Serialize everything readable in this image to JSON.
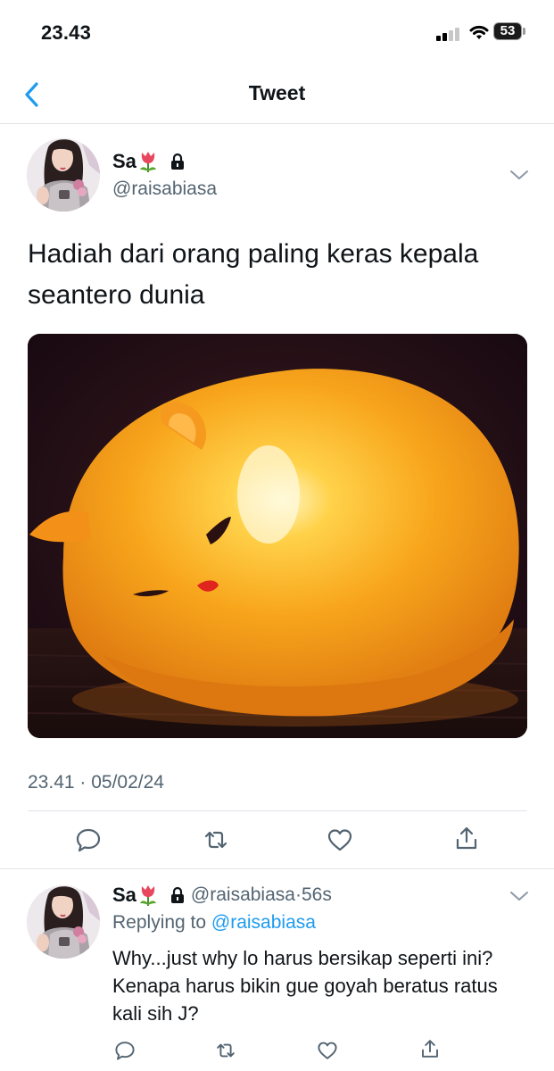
{
  "status_bar": {
    "time": "23.43",
    "battery": "53"
  },
  "header": {
    "title": "Tweet"
  },
  "tweet": {
    "author_name": "Sa",
    "handle": "@raisabiasa",
    "text": "Hadiah dari orang paling keras kepala seantero dunia",
    "timestamp": "23.41 · 05/02/24"
  },
  "reply": {
    "author_name": "Sa",
    "handle": "@raisabiasa",
    "age": "56s",
    "replying_prefix": "Replying to",
    "replying_to": "@raisabiasa",
    "text": "Why...just why lo harus bersikap seperti ini? Kenapa harus bikin gue goyah beratus ratus kali sih J?"
  },
  "colors": {
    "accent": "#1d9bf0",
    "secondary_text": "#536471",
    "divider": "#e1e4e8"
  },
  "icons": [
    "back-chevron-icon",
    "tulip-icon",
    "lock-icon",
    "chevron-down-icon",
    "reply-icon",
    "retweet-icon",
    "like-icon",
    "share-icon"
  ]
}
